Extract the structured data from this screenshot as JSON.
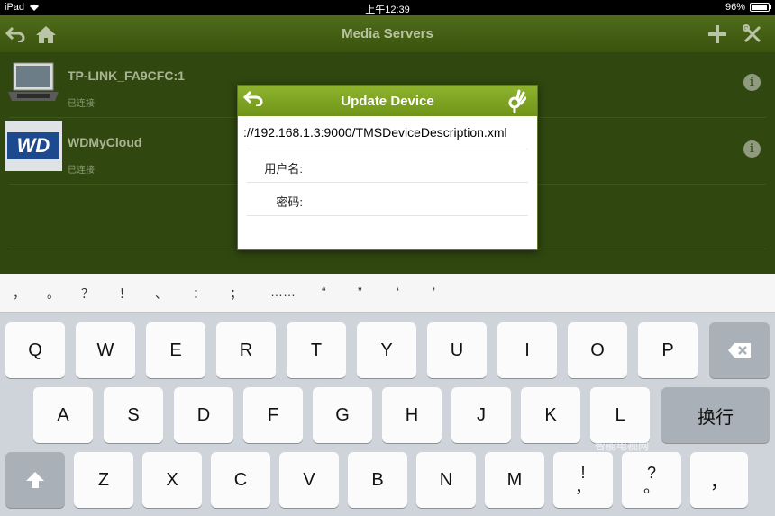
{
  "status_bar": {
    "device": "iPad",
    "time": "上午12:39",
    "battery": "96%",
    "battery_level": 0.96
  },
  "nav": {
    "title": "Media Servers",
    "back_icon": "back-arrow-icon",
    "home_icon": "home-icon",
    "add_icon": "plus-icon",
    "settings_icon": "tools-icon"
  },
  "servers": [
    {
      "name": "TP-LINK_FA9CFC:1",
      "status": "已连接",
      "icon": "laptop-icon"
    },
    {
      "name": "WDMyCloud",
      "status": "已连接",
      "icon": "wd-logo-icon",
      "logo_text": "WD"
    }
  ],
  "dialog": {
    "title": "Update Device",
    "url": "://192.168.1.3:9000/TMSDeviceDescription.xml",
    "username_label": "用户名:",
    "password_label": "密码:"
  },
  "keyboard": {
    "punctuation": [
      "，",
      "。",
      "？",
      "！",
      "、",
      "：",
      "；",
      "……",
      "“",
      "”",
      "‘",
      "’"
    ],
    "row1": [
      "Q",
      "W",
      "E",
      "R",
      "T",
      "Y",
      "U",
      "I",
      "O",
      "P"
    ],
    "row2": [
      "A",
      "S",
      "D",
      "F",
      "G",
      "H",
      "J",
      "K",
      "L"
    ],
    "row3": [
      "Z",
      "X",
      "C",
      "V",
      "B",
      "N",
      "M"
    ],
    "return_label": "换行",
    "key_excl_top": "!",
    "key_excl_bottom": "，",
    "key_q_top": "?",
    "key_q_bottom": "。",
    "key_comma": "，"
  },
  "watermark": "智能电视网",
  "colors": {
    "nav": "#4f6c1a",
    "content_bg": "#304710",
    "dialog_header": "#7fa424",
    "keyboard_bg": "#cfd4da"
  }
}
